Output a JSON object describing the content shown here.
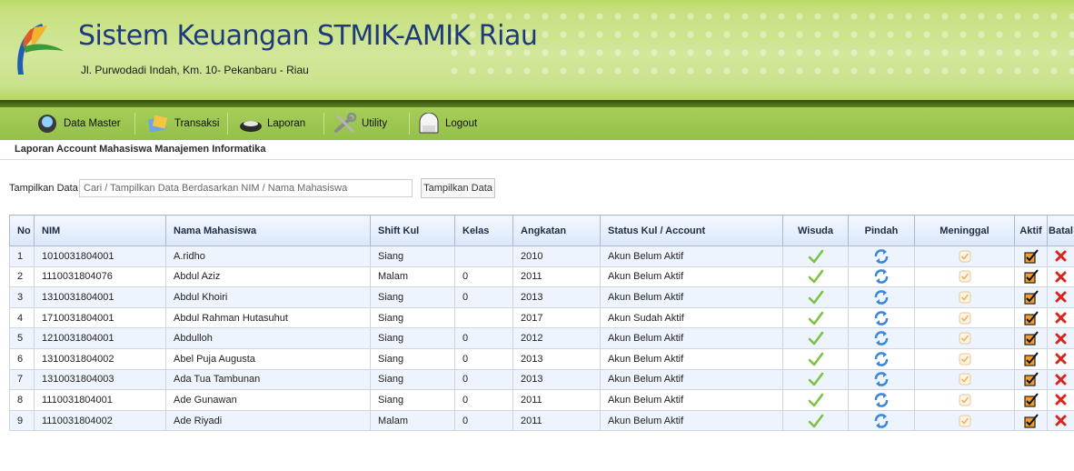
{
  "app": {
    "title": "Sistem Keuangan STMIK-AMIK Riau",
    "address": "Jl. Purwodadi Indah, Km. 10- Pekanbaru - Riau"
  },
  "menu": [
    {
      "label": "Data Master",
      "icon": "data-master-icon"
    },
    {
      "label": "Transaksi",
      "icon": "transaksi-icon"
    },
    {
      "label": "Laporan",
      "icon": "laporan-icon"
    },
    {
      "label": "Utility",
      "icon": "utility-icon"
    },
    {
      "label": "Logout",
      "icon": "logout-icon"
    }
  ],
  "breadcrumb": "Laporan Account Mahasiswa Manajemen Informatika",
  "filter": {
    "label": "Tampilkan Data",
    "placeholder": "Cari / Tampilkan Data Berdasarkan NIM / Nama Mahasiswa",
    "button": "Tampilkan Data"
  },
  "table": {
    "headers": [
      "No",
      "NIM",
      "Nama Mahasiswa",
      "Shift Kul",
      "Kelas",
      "Angkatan",
      "Status Kul / Account",
      "Wisuda",
      "Pindah",
      "Meninggal",
      "Aktif",
      "Batal"
    ],
    "rows": [
      {
        "no": "1",
        "nim": "1010031804001",
        "nama": "A.ridho",
        "shift": "Siang",
        "kelas": "",
        "angkatan": "2010",
        "status": "Akun Belum Aktif"
      },
      {
        "no": "2",
        "nim": "1110031804076",
        "nama": "Abdul Aziz",
        "shift": "Malam",
        "kelas": "0",
        "angkatan": "2011",
        "status": "Akun Belum Aktif"
      },
      {
        "no": "3",
        "nim": "1310031804001",
        "nama": "Abdul Khoiri",
        "shift": "Siang",
        "kelas": "0",
        "angkatan": "2013",
        "status": "Akun Belum Aktif"
      },
      {
        "no": "4",
        "nim": "1710031804001",
        "nama": "Abdul Rahman Hutasuhut",
        "shift": "Siang",
        "kelas": "",
        "angkatan": "2017",
        "status": "Akun Sudah Aktif"
      },
      {
        "no": "5",
        "nim": "1210031804001",
        "nama": "Abdulloh",
        "shift": "Siang",
        "kelas": "0",
        "angkatan": "2012",
        "status": "Akun Belum Aktif"
      },
      {
        "no": "6",
        "nim": "1310031804002",
        "nama": "Abel Puja Augusta",
        "shift": "Siang",
        "kelas": "0",
        "angkatan": "2013",
        "status": "Akun Belum Aktif"
      },
      {
        "no": "7",
        "nim": "1310031804003",
        "nama": "Ada Tua Tambunan",
        "shift": "Siang",
        "kelas": "0",
        "angkatan": "2013",
        "status": "Akun Belum Aktif"
      },
      {
        "no": "8",
        "nim": "1110031804001",
        "nama": "Ade Gunawan",
        "shift": "Siang",
        "kelas": "0",
        "angkatan": "2011",
        "status": "Akun Belum Aktif"
      },
      {
        "no": "9",
        "nim": "1110031804002",
        "nama": "Ade Riyadi",
        "shift": "Malam",
        "kelas": "0",
        "angkatan": "2011",
        "status": "Akun Belum Aktif"
      }
    ]
  },
  "colors": {
    "header_green": "#c6e07e",
    "menu_green": "#a6ce59",
    "title_blue": "#1f3a7a",
    "check_green": "#7cc243",
    "cancel_red": "#d9261c"
  }
}
